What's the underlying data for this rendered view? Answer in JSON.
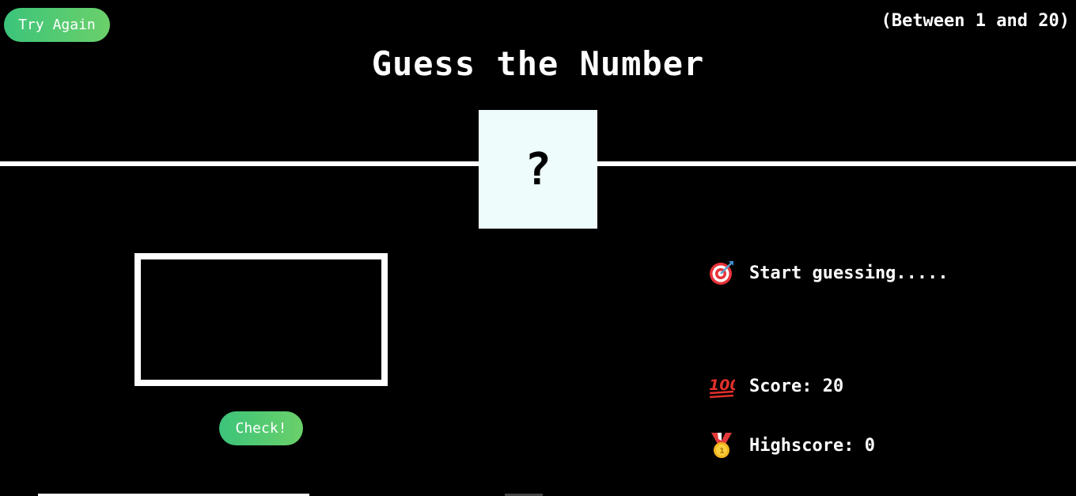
{
  "header": {
    "again_label": "Try Again",
    "range_text": "(Between 1 and 20)",
    "title": "Guess the Number"
  },
  "secret": {
    "display": "?"
  },
  "guess": {
    "value": "",
    "check_label": "Check!"
  },
  "stats": {
    "message": "Start guessing.....",
    "score_label": "Score: 20",
    "highscore_label": "Highscore: 0",
    "message_icon": "target-icon",
    "score_icon": "hundred-points-icon",
    "highscore_icon": "medal-icon"
  },
  "colors": {
    "background": "#000000",
    "button_gradient_start": "#3cc47a",
    "button_gradient_end": "#6bd06a",
    "number_box": "#eefcfc"
  }
}
